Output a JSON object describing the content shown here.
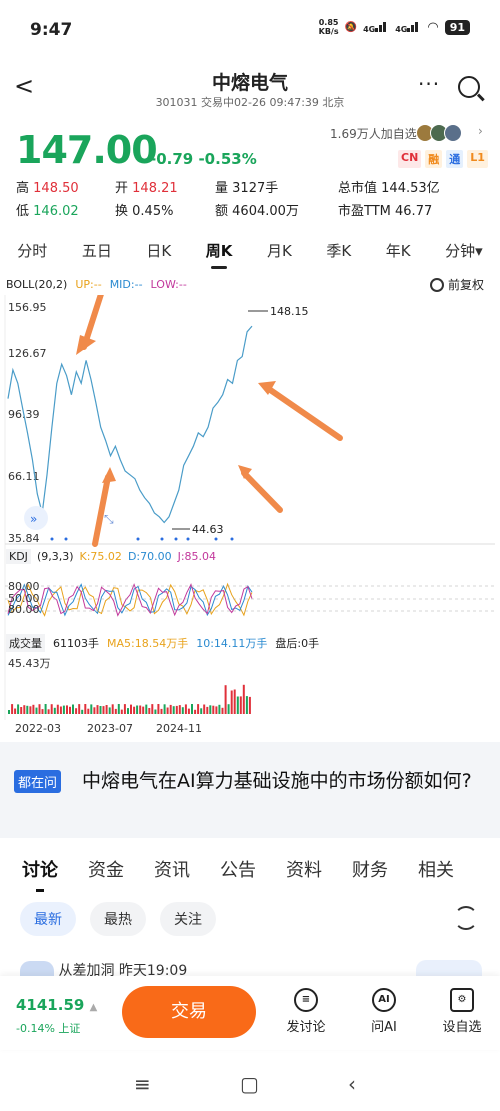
{
  "status_bar": {
    "time": "9:47",
    "net_speed": "0.85",
    "net_unit": "KB/s",
    "sig1": "4G",
    "sig2": "4G",
    "battery": "91"
  },
  "header": {
    "back": "<",
    "title": "中熔电气",
    "subtitle": "301031 交易中02-26 09:47:39 北京",
    "more": "···"
  },
  "quote": {
    "price": "147.00",
    "change": "-0.79 -0.53%",
    "followers": "1.69万人加自选",
    "tags": [
      "CN",
      "融",
      "通",
      "L1"
    ],
    "high_label": "高",
    "high": "148.50",
    "open_label": "开",
    "open": "148.21",
    "volume_label": "量",
    "volume": "3127手",
    "mktcap_label": "总市值",
    "mktcap": "144.53亿",
    "low_label": "低",
    "low": "146.02",
    "turnover_label": "换",
    "turnover": "0.45%",
    "amount_label": "额",
    "amount": "4604.00万",
    "pe_label": "市盈TTM",
    "pe": "46.77"
  },
  "periods": [
    "分时",
    "五日",
    "日K",
    "周K",
    "月K",
    "季K",
    "年K",
    "分钟▾"
  ],
  "active_period": "周K",
  "boll": {
    "name": "BOLL(20,2)",
    "up": "UP:--",
    "mid": "MID:--",
    "low": "LOW:--",
    "adjust": "前复权"
  },
  "y_axis": [
    "156.95",
    "126.67",
    "96.39",
    "66.11",
    "35.84"
  ],
  "kdj": {
    "name": "KDJ",
    "params": "(9,3,3)",
    "k": "K:75.02",
    "d": "D:70.00",
    "j": "J:85.04",
    "levels": [
      "80.00",
      "50.00",
      "20.00"
    ]
  },
  "volume": {
    "name": "成交量",
    "value": "61103手",
    "ma5": "MA5:18.54万手",
    "ma10": "10:14.11万手",
    "after": "盘后:0手",
    "max": "45.43万"
  },
  "dates": [
    "2022-03",
    "2023-07",
    "2024-11"
  ],
  "chart_data": {
    "type": "line",
    "title": "",
    "max_label": "148.15",
    "min_label": "44.63",
    "ylim": [
      35.84,
      156.95
    ],
    "x": [
      "2022-03",
      "2023-07",
      "2024-11"
    ],
    "series": [
      {
        "values": [
          110,
          125,
          118,
          105,
          92,
          78,
          60,
          50,
          70,
          95,
          118,
          128,
          122,
          112,
          124,
          118,
          130,
          120,
          108,
          95,
          88,
          80,
          85,
          78,
          72,
          70,
          68,
          62,
          58,
          55,
          50,
          48,
          45,
          48,
          55,
          62,
          75,
          80,
          85,
          92,
          90,
          95,
          105,
          108,
          112,
          120,
          118,
          130,
          132,
          145,
          148
        ]
      }
    ],
    "grid": true
  },
  "qa": {
    "badge": "都在问",
    "question": "中熔电气在AI算力基础设施中的市场份额如何?"
  },
  "tabs": [
    "讨论",
    "资金",
    "资讯",
    "公告",
    "资料",
    "财务",
    "相关"
  ],
  "pills": [
    "最新",
    "最热",
    "关注"
  ],
  "post_preview": "从差加洞  昨天19:09",
  "bottom": {
    "index_value": "4141.59",
    "index_change": "-0.14% 上证",
    "trade": "交易",
    "post": "发讨论",
    "ask": "问AI",
    "fav": "设自选"
  },
  "colors": {
    "green": "#1aa55b",
    "red": "#e0303a",
    "orange": "#f96a18",
    "blue": "#2a6de0"
  }
}
